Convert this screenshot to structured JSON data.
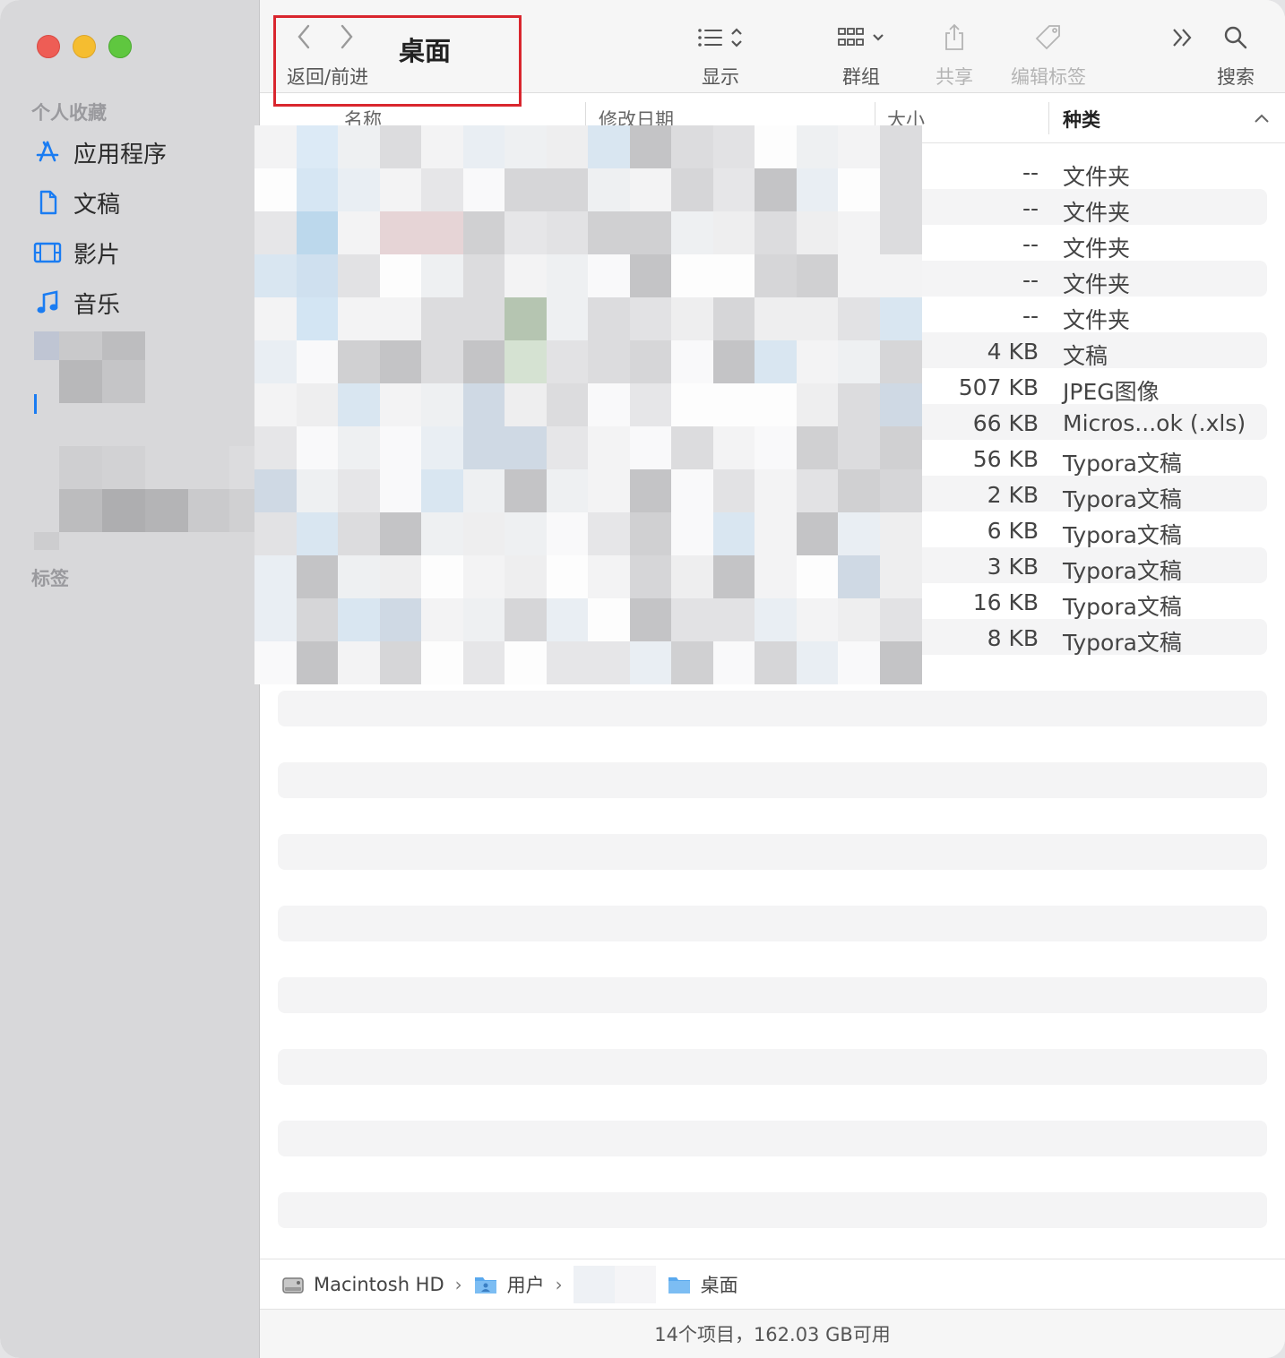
{
  "window": {
    "title": "桌面",
    "nav_label": "返回/前进"
  },
  "toolbar": {
    "view_label": "显示",
    "group_label": "群组",
    "share_label": "共享",
    "tags_label": "编辑标签",
    "search_label": "搜索"
  },
  "sidebar": {
    "favorites_heading": "个人收藏",
    "tags_heading": "标签",
    "items": [
      {
        "label": "应用程序",
        "icon": "applications-icon"
      },
      {
        "label": "文稿",
        "icon": "document-icon"
      },
      {
        "label": "影片",
        "icon": "film-icon"
      },
      {
        "label": "音乐",
        "icon": "music-note-icon"
      }
    ]
  },
  "columns": {
    "name": "名称",
    "modified": "修改日期",
    "size": "大小",
    "kind": "种类"
  },
  "rows": [
    {
      "size": "--",
      "kind": "文件夹"
    },
    {
      "size": "--",
      "kind": "文件夹"
    },
    {
      "size": "--",
      "kind": "文件夹"
    },
    {
      "size": "--",
      "kind": "文件夹"
    },
    {
      "size": "--",
      "kind": "文件夹"
    },
    {
      "size": "4 KB",
      "kind": "文稿"
    },
    {
      "size": "507 KB",
      "kind": "JPEG图像"
    },
    {
      "size": "66 KB",
      "kind": "Micros...ok (.xls)"
    },
    {
      "size": "56 KB",
      "kind": "Typora文稿"
    },
    {
      "size": "2 KB",
      "kind": "Typora文稿"
    },
    {
      "size": "6 KB",
      "kind": "Typora文稿"
    },
    {
      "size": "3 KB",
      "kind": "Typora文稿"
    },
    {
      "size": "16 KB",
      "kind": "Typora文稿"
    },
    {
      "size": "8 KB",
      "kind": "Typora文稿"
    }
  ],
  "pathbar": {
    "disk": "Macintosh HD",
    "users": "用户",
    "current": "桌面"
  },
  "status": "14个项目，162.03 GB可用",
  "colors": {
    "accent": "#1a7cf2",
    "highlight_box": "#d9262e",
    "sidebar_bg": "#d8d8da"
  }
}
